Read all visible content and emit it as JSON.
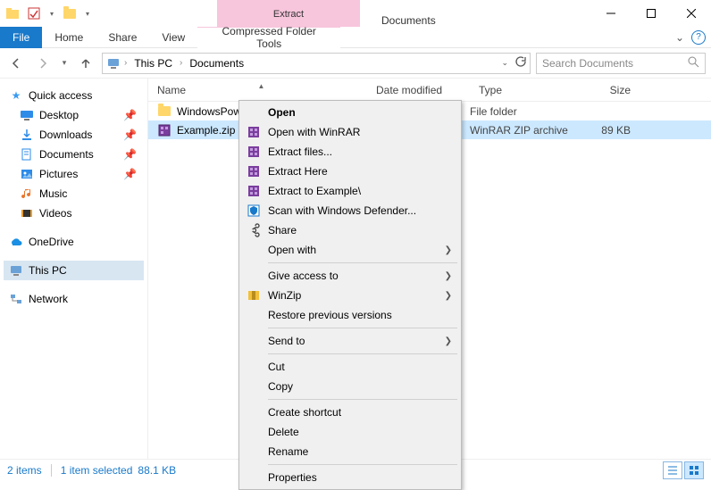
{
  "window": {
    "title": "Documents",
    "contextual_tab": "Extract",
    "contextual_group": "Compressed Folder Tools"
  },
  "ribbon": {
    "file": "File",
    "tabs": [
      "Home",
      "Share",
      "View"
    ]
  },
  "address": {
    "root": "This PC",
    "folder": "Documents",
    "search_placeholder": "Search Documents"
  },
  "sidebar": {
    "quick_access": "Quick access",
    "items": [
      {
        "label": "Desktop",
        "pinned": true
      },
      {
        "label": "Downloads",
        "pinned": true
      },
      {
        "label": "Documents",
        "pinned": true
      },
      {
        "label": "Pictures",
        "pinned": true
      },
      {
        "label": "Music",
        "pinned": false
      },
      {
        "label": "Videos",
        "pinned": false
      }
    ],
    "onedrive": "OneDrive",
    "this_pc": "This PC",
    "network": "Network"
  },
  "columns": {
    "name": "Name",
    "date": "Date modified",
    "type": "Type",
    "size": "Size"
  },
  "files": [
    {
      "name": "WindowsPower",
      "date": "",
      "type": "File folder",
      "size": "",
      "icon": "folder",
      "selected": false
    },
    {
      "name": "Example.zip",
      "date": "",
      "type": "WinRAR ZIP archive",
      "size": "89 KB",
      "icon": "zip",
      "selected": true
    }
  ],
  "context_menu": {
    "items": [
      {
        "label": "Open",
        "bold": true
      },
      {
        "label": "Open with WinRAR",
        "icon": "winrar"
      },
      {
        "label": "Extract files...",
        "icon": "winrar"
      },
      {
        "label": "Extract Here",
        "icon": "winrar"
      },
      {
        "label": "Extract to Example\\",
        "icon": "winrar"
      },
      {
        "label": "Scan with Windows Defender...",
        "icon": "defender"
      },
      {
        "label": "Share",
        "icon": "share"
      },
      {
        "label": "Open with",
        "submenu": true
      },
      {
        "sep": true
      },
      {
        "label": "Give access to",
        "submenu": true
      },
      {
        "label": "WinZip",
        "icon": "winzip",
        "submenu": true
      },
      {
        "label": "Restore previous versions"
      },
      {
        "sep": true
      },
      {
        "label": "Send to",
        "submenu": true
      },
      {
        "sep": true
      },
      {
        "label": "Cut"
      },
      {
        "label": "Copy"
      },
      {
        "sep": true
      },
      {
        "label": "Create shortcut"
      },
      {
        "label": "Delete"
      },
      {
        "label": "Rename"
      },
      {
        "sep": true
      },
      {
        "label": "Properties"
      }
    ]
  },
  "status": {
    "count": "2 items",
    "selection": "1 item selected",
    "size": "88.1 KB"
  }
}
